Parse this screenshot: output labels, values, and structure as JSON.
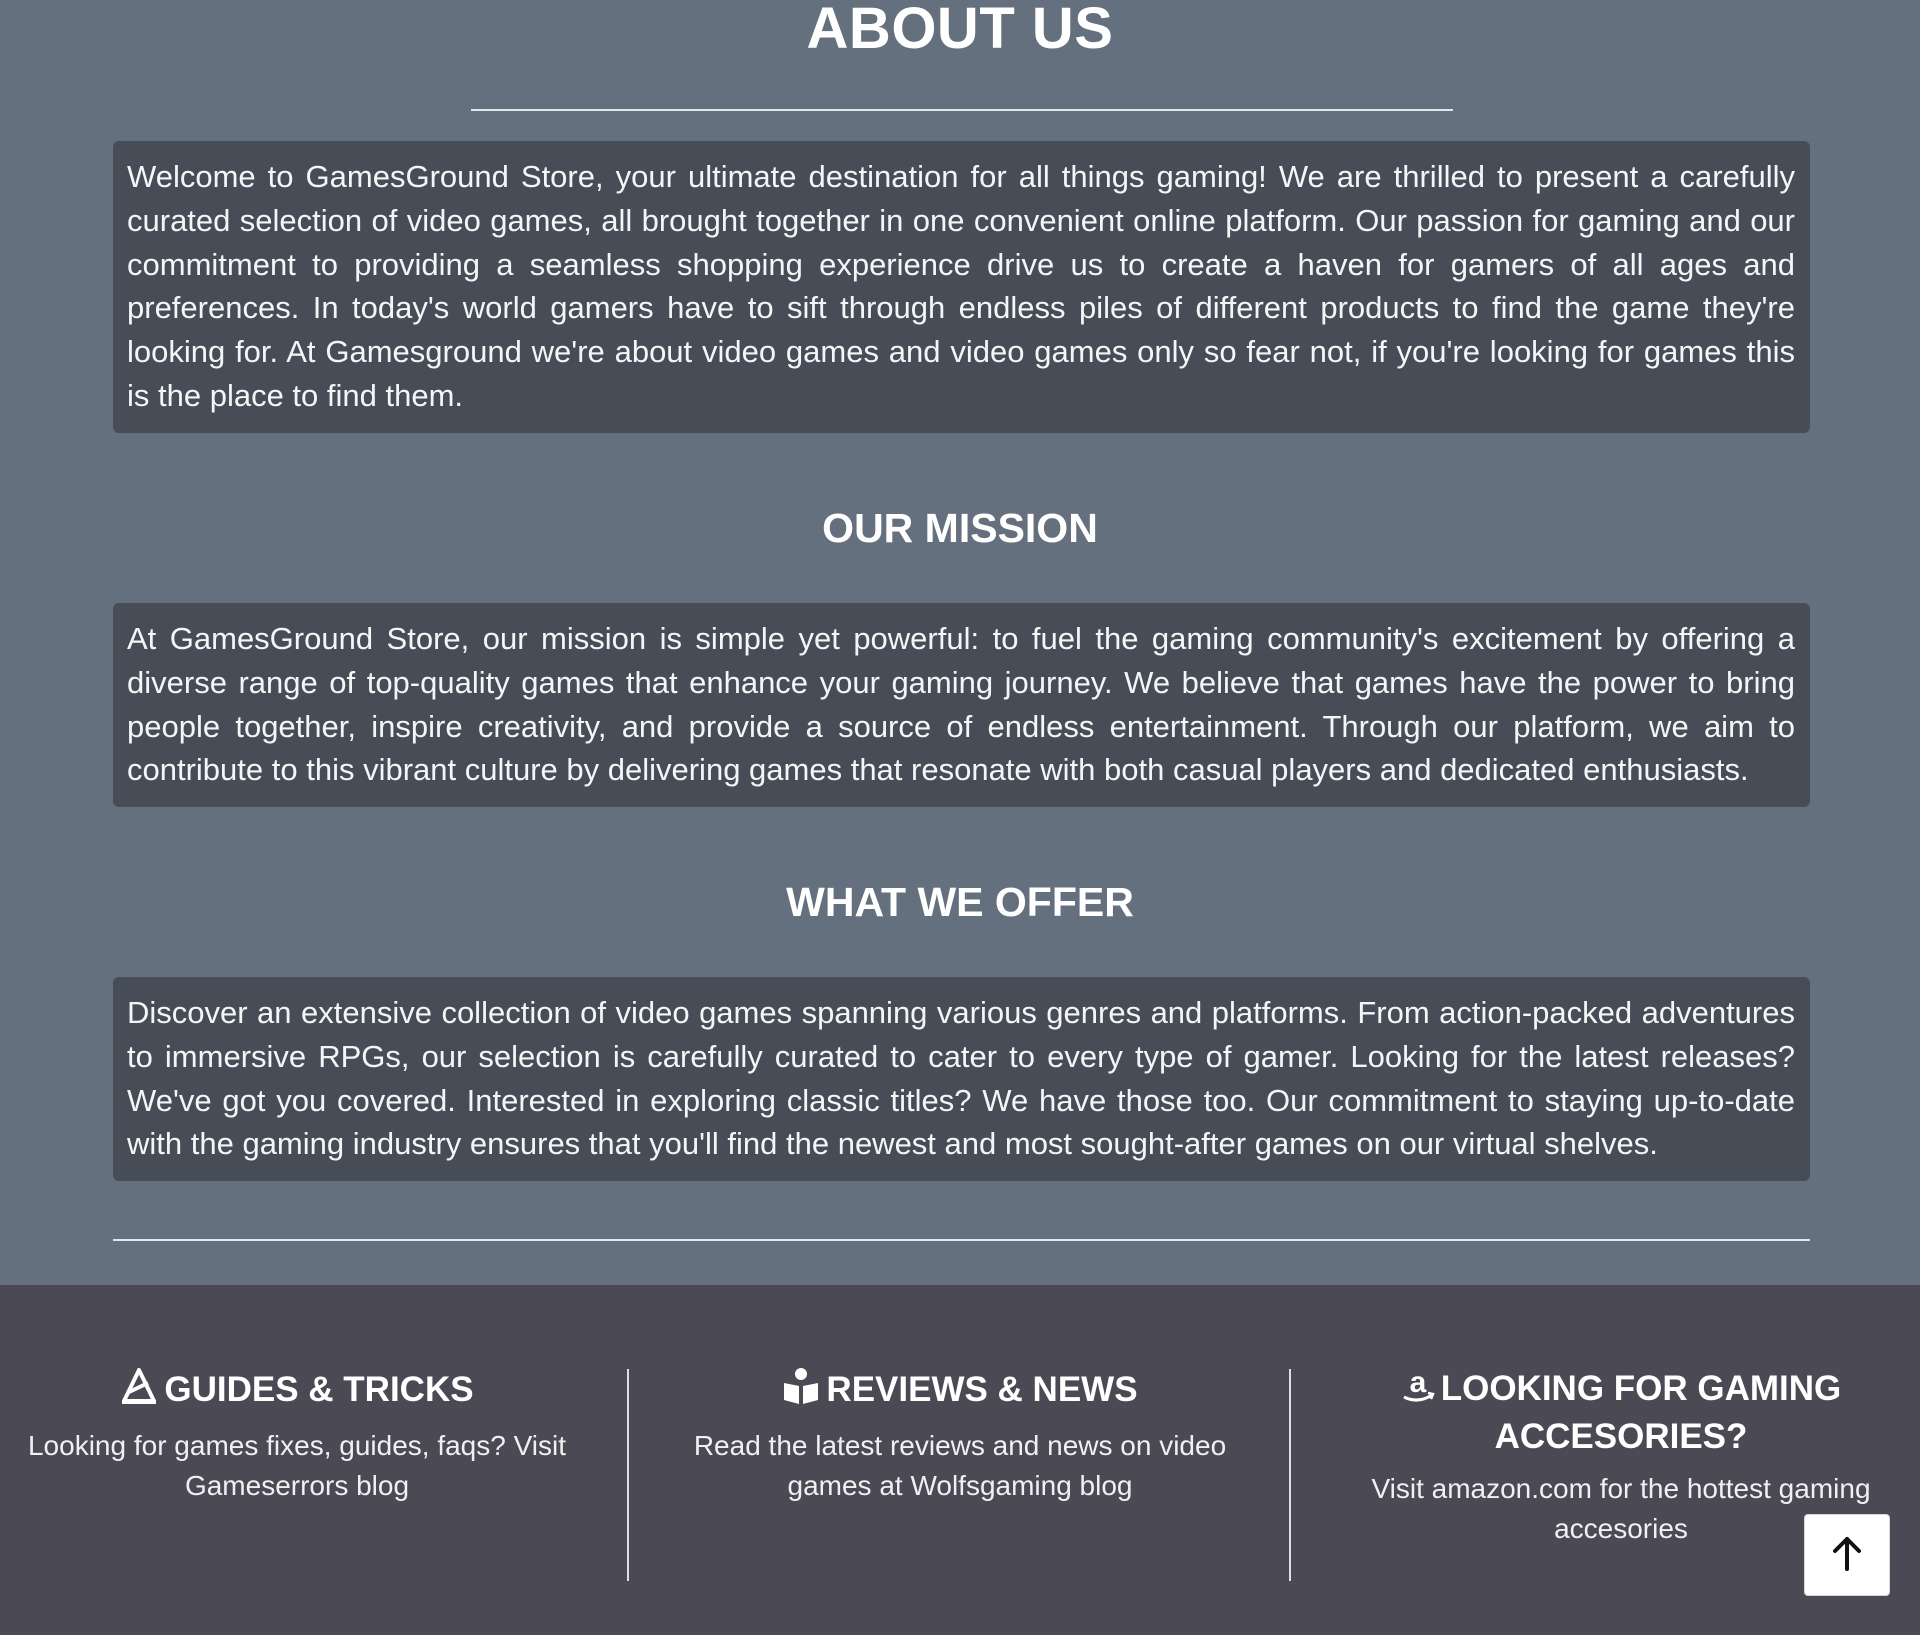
{
  "about": {
    "title": "ABOUT US",
    "body": "Welcome to GamesGround Store, your ultimate destination for all things gaming! We are thrilled to present a carefully curated selection of video games, all brought together in one convenient online platform. Our passion for gaming and our commitment to providing a seamless shopping experience drive us to create a haven for gamers of all ages and preferences. In today's world gamers have to sift through endless piles of different products to find the game they're looking for. At Gamesground we're about video games and video games only so fear not, if you're looking for games this is the place to find them."
  },
  "mission": {
    "title": "OUR MISSION",
    "body": "At GamesGround Store, our mission is simple yet powerful: to fuel the gaming community's excitement by offering a diverse range of top-quality games that enhance your gaming journey. We believe that games have the power to bring people together, inspire creativity, and provide a source of endless entertainment. Through our platform, we aim to contribute to this vibrant culture by delivering games that resonate with both casual players and dedicated enthusiasts."
  },
  "offer": {
    "title": "WHAT WE OFFER",
    "body": "Discover an extensive collection of video games spanning various genres and platforms. From action-packed adventures to immersive RPGs, our selection is carefully curated to cater to every type of gamer. Looking for the latest releases? We've got you covered. Interested in exploring classic titles? We have those too. Our commitment to staying up-to-date with the gaming industry ensures that you'll find the newest and most sought-after games on our virtual shelves."
  },
  "footer": {
    "guides": {
      "icon": "wizard-hat-icon",
      "title": "GUIDES & TRICKS",
      "text": "Looking for games fixes, guides, faqs? Visit Gameserrors blog"
    },
    "reviews": {
      "icon": "book-reader-icon",
      "title": "REVIEWS & NEWS",
      "text": "Read the latest reviews and news on video games at Wolfsgaming blog"
    },
    "accessories": {
      "icon": "amazon-icon",
      "title": "LOOKING FOR GAMING ACCESORIES?",
      "text": "Visit amazon.com for the hottest gaming accesories"
    }
  },
  "back_to_top": {
    "icon": "arrow-up-icon"
  },
  "colors": {
    "page_background": "#65707e",
    "text_box_background": "#474d57",
    "footer_background": "#4a4954",
    "text": "#ffffff"
  }
}
